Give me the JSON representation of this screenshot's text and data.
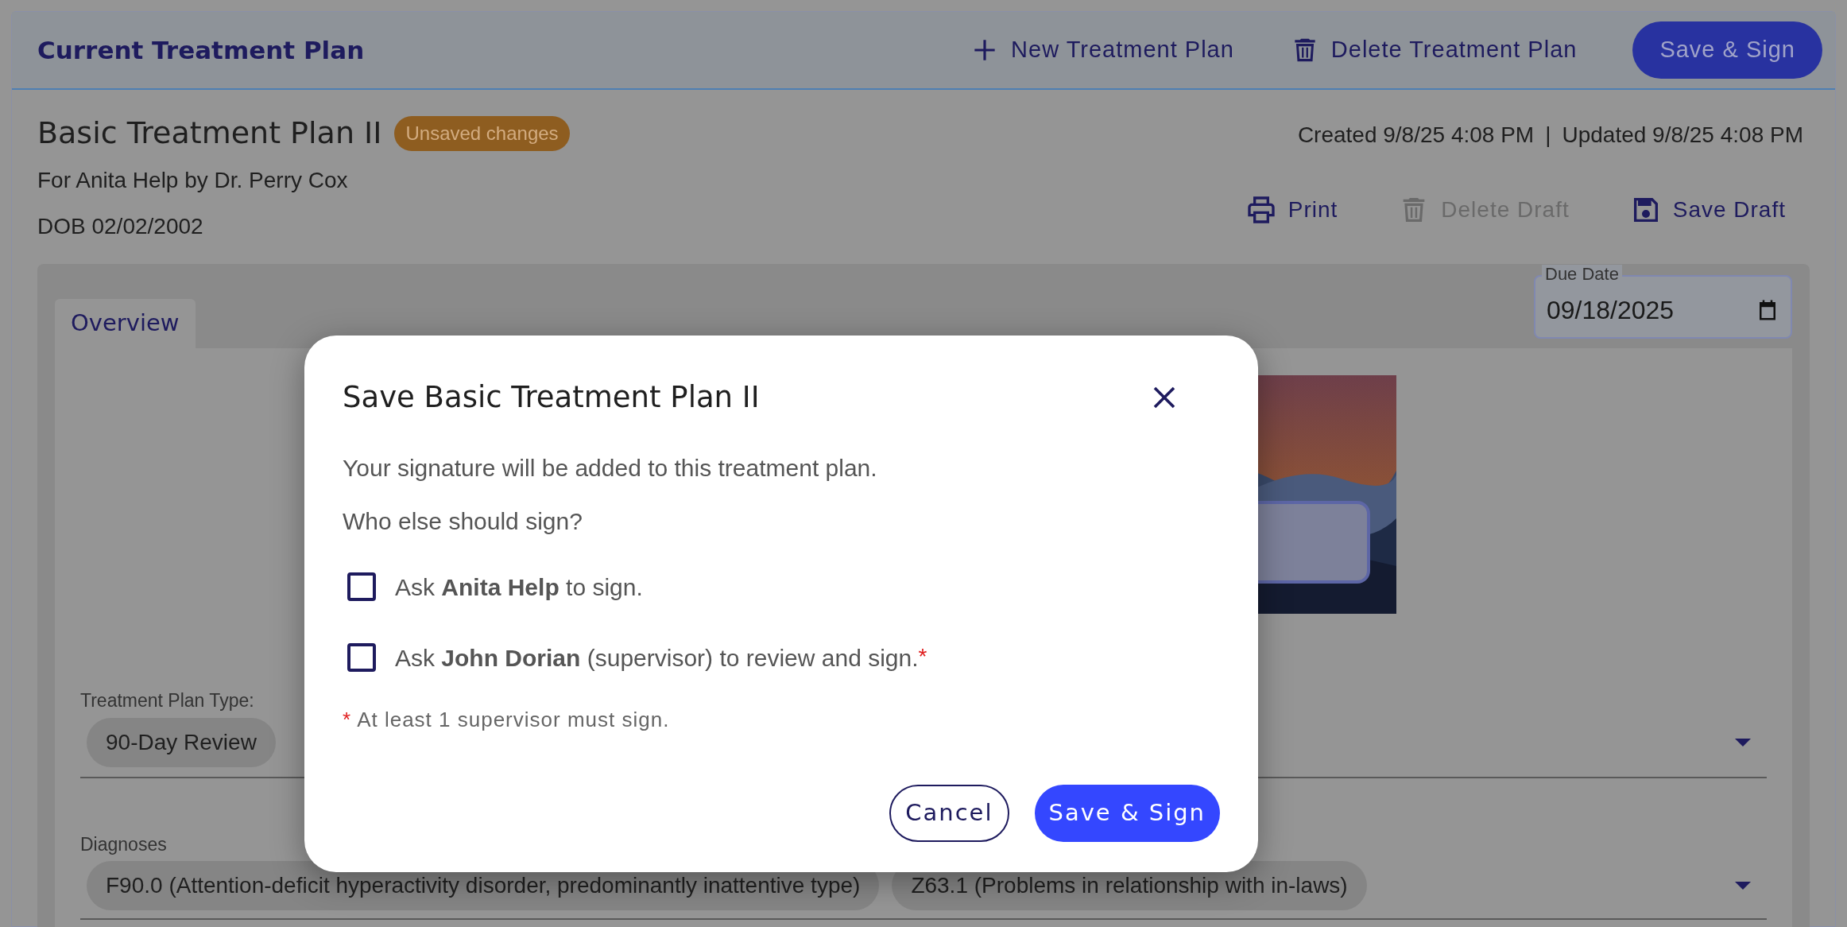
{
  "header": {
    "title": "Current Treatment Plan",
    "actions": [
      {
        "label": "New Treatment Plan",
        "kind": "plus"
      },
      {
        "label": "Delete Treatment Plan",
        "kind": "trash"
      }
    ],
    "primary_button": "Save & Sign"
  },
  "plan": {
    "title": "Basic Treatment Plan II",
    "badge": "Unsaved changes",
    "subtitle": "For Anita Help by Dr. Perry Cox",
    "dob": "DOB 02/02/2002",
    "created": "Created 9/8/25 4:08 PM",
    "separator": "|",
    "updated": "Updated 9/8/25 4:08 PM"
  },
  "draft_actions": [
    {
      "label": "Print",
      "kind": "print",
      "disabled": false
    },
    {
      "label": "Delete Draft",
      "kind": "trash",
      "disabled": true
    },
    {
      "label": "Save Draft",
      "kind": "save",
      "disabled": false
    }
  ],
  "tabs": [
    {
      "label": "Overview",
      "selected": true
    }
  ],
  "due_date": {
    "label": "Due Date",
    "value": "09/18/2025"
  },
  "treatment_plan_type": {
    "label": "Treatment Plan Type:",
    "chips": [
      "90-Day Review"
    ]
  },
  "diagnoses": {
    "label": "Diagnoses",
    "chips": [
      "F90.0 (Attention-deficit hyperactivity disorder, predominantly inattentive type)",
      "Z63.1 (Problems in relationship with in-laws)"
    ]
  },
  "dialog": {
    "title": "Save Basic Treatment Plan II",
    "message": "Your signature will be added to this treatment plan.",
    "question": "Who else should sign?",
    "options": [
      {
        "text": "Ask **Anita Help** to sign.",
        "checked": false
      },
      {
        "text": "Ask **John Dorian** (supervisor) to review and sign.",
        "checked": false,
        "required_mark": "*"
      }
    ],
    "note": {
      "mark": "*",
      "text": "At least 1 supervisor must sign."
    },
    "buttons": [
      {
        "label": "Cancel",
        "kind": "outline"
      },
      {
        "label": "Save & Sign",
        "kind": "primary"
      }
    ]
  }
}
